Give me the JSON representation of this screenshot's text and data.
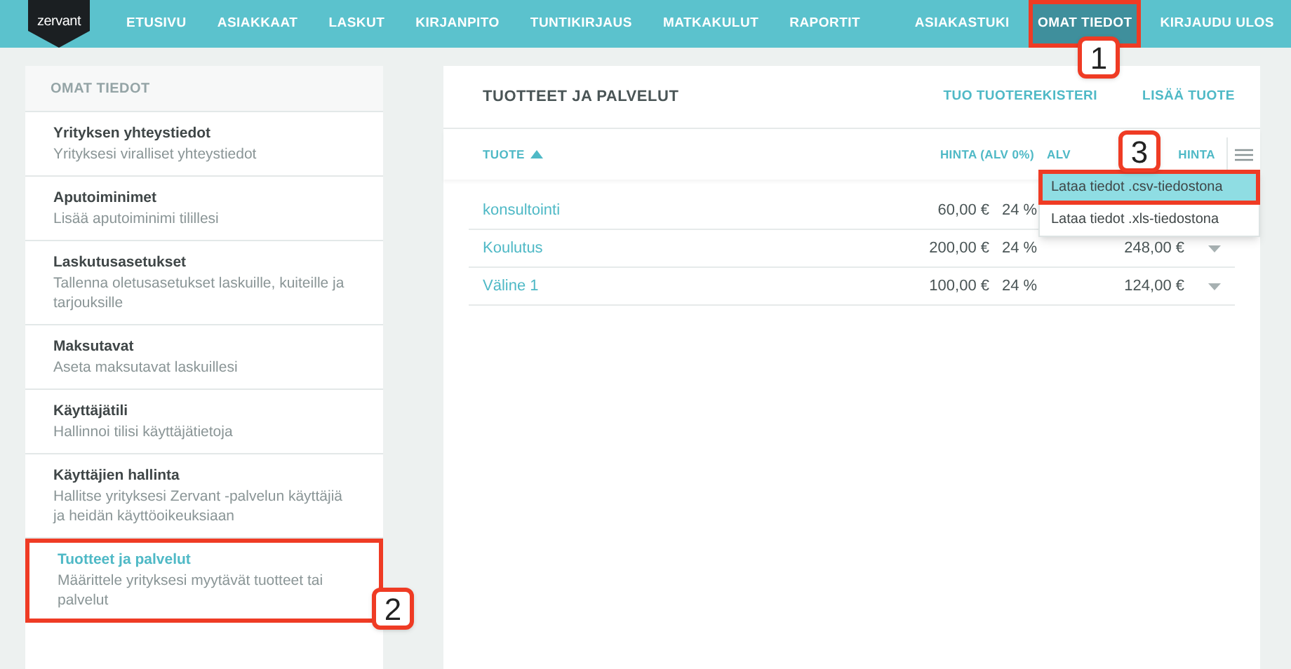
{
  "logo": {
    "text": "zervant"
  },
  "nav": {
    "items": [
      {
        "label": "ETUSIVU",
        "selected": false
      },
      {
        "label": "ASIAKKAAT",
        "selected": false
      },
      {
        "label": "LASKUT",
        "selected": false
      },
      {
        "label": "KIRJANPITO",
        "selected": false
      },
      {
        "label": "TUNTIKIRJAUS",
        "selected": false
      },
      {
        "label": "MATKAKULUT",
        "selected": false
      },
      {
        "label": "RAPORTIT",
        "selected": false
      }
    ],
    "right_items": [
      {
        "label": "ASIAKASTUKI",
        "selected": false
      },
      {
        "label": "OMAT TIEDOT",
        "selected": true,
        "callout": "1"
      },
      {
        "label": "KIRJAUDU ULOS",
        "selected": false
      }
    ]
  },
  "sidebar": {
    "title": "OMAT TIEDOT",
    "items": [
      {
        "title": "Yrityksen yhteystiedot",
        "description": "Yrityksesi viralliset yhteystiedot",
        "selected": false
      },
      {
        "title": "Aputoiminimet",
        "description": "Lisää aputoiminimi tilillesi",
        "selected": false
      },
      {
        "title": "Laskutusasetukset",
        "description": "Tallenna oletusasetukset laskuille, kuiteille ja tarjouksille",
        "selected": false
      },
      {
        "title": "Maksutavat",
        "description": "Aseta maksutavat laskuillesi",
        "selected": false
      },
      {
        "title": "Käyttäjätili",
        "description": "Hallinnoi tilisi käyttäjätietoja",
        "selected": false
      },
      {
        "title": "Käyttäjien hallinta",
        "description": "Hallitse yrityksesi Zervant -palvelun käyttäjiä ja heidän käyttöoikeuksiaan",
        "selected": false
      },
      {
        "title": "Tuotteet ja palvelut",
        "description": "Määrittele yrityksesi myytävät tuotteet tai palvelut",
        "selected": true,
        "callout": "2"
      }
    ]
  },
  "main": {
    "title": "TUOTTEET JA PALVELUT",
    "actions": [
      "TUO TUOTEREKISTERI",
      "LISÄÄ TUOTE"
    ],
    "table": {
      "columns": [
        "TUOTE",
        "HINTA (ALV 0%)",
        "ALV",
        "HINTA"
      ],
      "rows": [
        {
          "name": "konsultointi",
          "price": "60,00 €",
          "vat": "24 %"
        },
        {
          "name": "Koulutus",
          "price": "200,00 €",
          "vat": "24 %",
          "total": "248,00 €"
        },
        {
          "name": "Väline 1",
          "price": "100,00 €",
          "vat": "24 %",
          "total": "124,00 €"
        }
      ]
    },
    "menu": {
      "callout": "3",
      "items": [
        {
          "label": "Lataa tiedot .csv-tiedostona",
          "selected": true
        },
        {
          "label": "Lataa tiedot .xls-tiedostona",
          "selected": false
        }
      ]
    }
  }
}
